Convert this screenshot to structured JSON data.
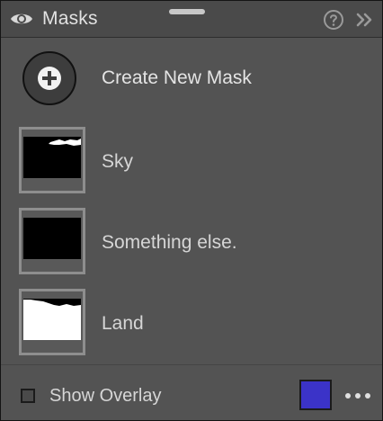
{
  "header": {
    "title": "Masks",
    "icons": {
      "visibility": "eye-icon",
      "help": "question-circle-icon",
      "collapse": "double-chevron-right-icon",
      "handle": "drag-handle"
    }
  },
  "create_mask": {
    "label": "Create New Mask",
    "icon": "plus-circle-icon"
  },
  "masks": [
    {
      "label": "Sky",
      "thumbnail": "sky-mask-thumbnail"
    },
    {
      "label": "Something else.",
      "thumbnail": "black-mask-thumbnail"
    },
    {
      "label": "Land",
      "thumbnail": "land-mask-thumbnail"
    }
  ],
  "footer": {
    "show_overlay_label": "Show Overlay",
    "show_overlay_checked": false,
    "overlay_color": "#3b33c8",
    "more_icon": "ellipsis-icon"
  },
  "colors": {
    "panel_bg": "#535353",
    "header_bg": "#4a4a4a",
    "thumb_border": "#8e8e8e",
    "text": "#dcdcdc"
  }
}
